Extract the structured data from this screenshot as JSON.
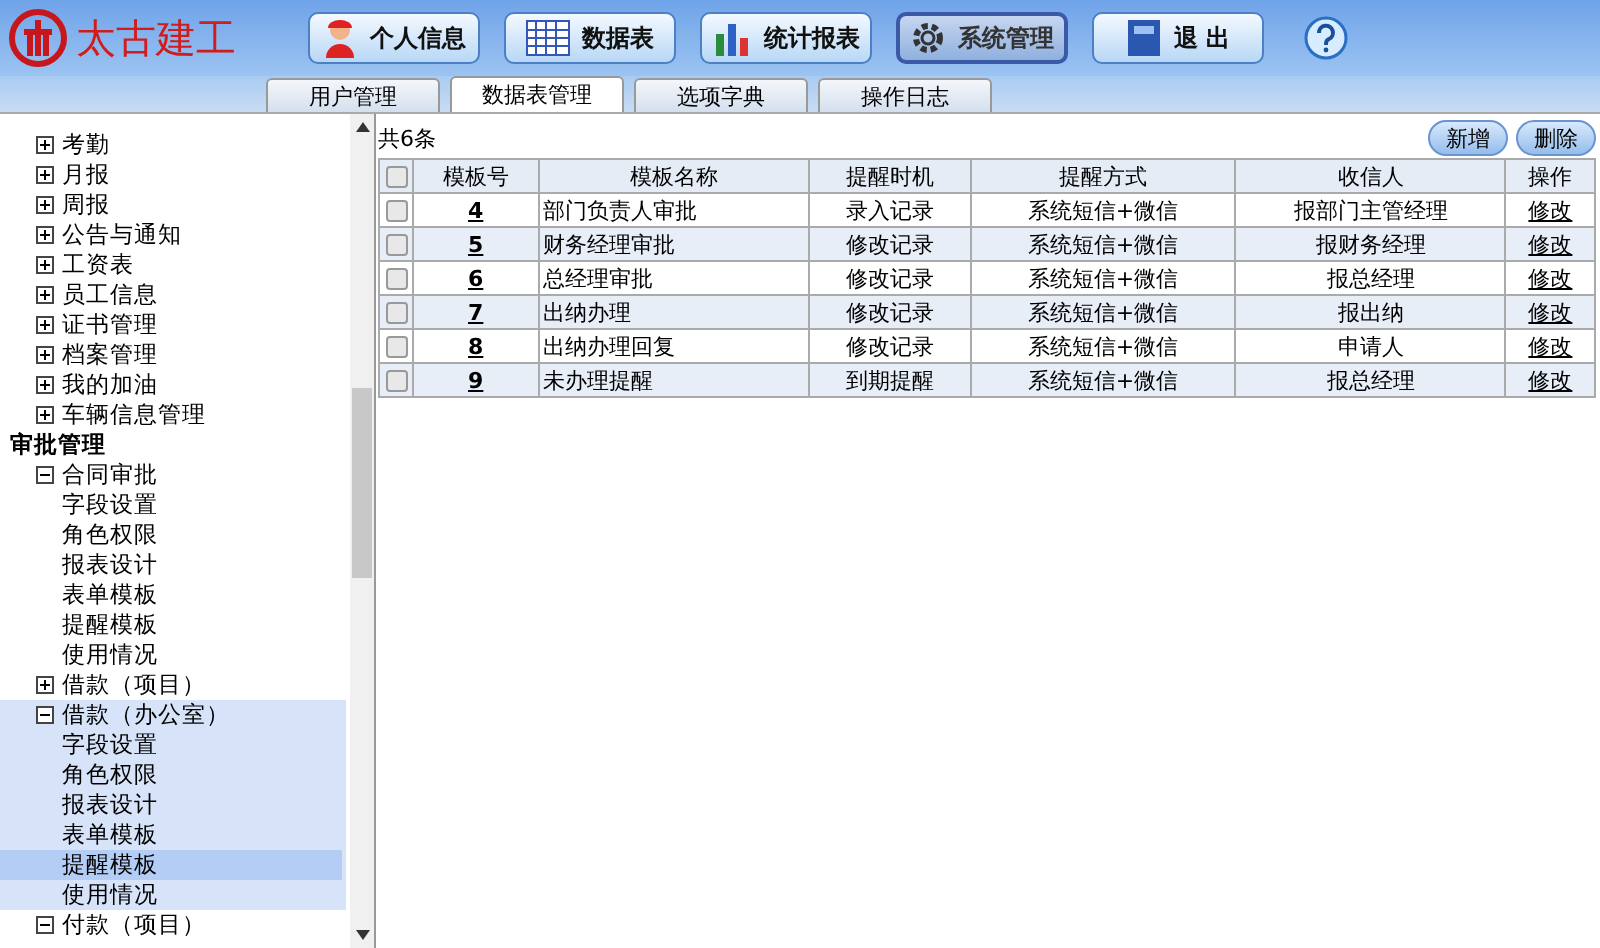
{
  "logo": {
    "text": "太古建工"
  },
  "nav": [
    {
      "label": "个人信息",
      "kind": "person",
      "selected": false
    },
    {
      "label": "数据表",
      "kind": "table",
      "selected": false
    },
    {
      "label": "统计报表",
      "kind": "chart",
      "selected": false
    },
    {
      "label": "系统管理",
      "kind": "settings",
      "selected": true
    },
    {
      "label": "退 出",
      "kind": "exit",
      "selected": false
    }
  ],
  "tabs": [
    {
      "label": "用户管理",
      "selected": false
    },
    {
      "label": "数据表管理",
      "selected": true
    },
    {
      "label": "选项字典",
      "selected": false
    },
    {
      "label": "操作日志",
      "selected": false
    }
  ],
  "sidebar": {
    "items": [
      {
        "kind": "folder",
        "label": "考勤",
        "expanded": false,
        "selected": false
      },
      {
        "kind": "folder",
        "label": "月报",
        "expanded": false,
        "selected": false
      },
      {
        "kind": "folder",
        "label": "周报",
        "expanded": false,
        "selected": false
      },
      {
        "kind": "folder",
        "label": "公告与通知",
        "expanded": false,
        "selected": false
      },
      {
        "kind": "folder",
        "label": "工资表",
        "expanded": false,
        "selected": false
      },
      {
        "kind": "folder",
        "label": "员工信息",
        "expanded": false,
        "selected": false
      },
      {
        "kind": "folder",
        "label": "证书管理",
        "expanded": false,
        "selected": false
      },
      {
        "kind": "folder",
        "label": "档案管理",
        "expanded": false,
        "selected": false
      },
      {
        "kind": "folder",
        "label": "我的加油",
        "expanded": false,
        "selected": false
      },
      {
        "kind": "folder",
        "label": "车辆信息管理",
        "expanded": false,
        "selected": false
      },
      {
        "kind": "group",
        "label": "审批管理"
      },
      {
        "kind": "folder",
        "label": "合同审批",
        "expanded": true,
        "selected": false,
        "children": [
          {
            "label": "字段设置",
            "selected": false
          },
          {
            "label": "角色权限",
            "selected": false
          },
          {
            "label": "报表设计",
            "selected": false
          },
          {
            "label": "表单模板",
            "selected": false
          },
          {
            "label": "提醒模板",
            "selected": false
          },
          {
            "label": "使用情况",
            "selected": false
          }
        ]
      },
      {
        "kind": "folder",
        "label": "借款（项目）",
        "expanded": false,
        "selected": false
      },
      {
        "kind": "folder",
        "label": "借款（办公室）",
        "expanded": true,
        "selected": true,
        "children": [
          {
            "label": "字段设置",
            "selected": false
          },
          {
            "label": "角色权限",
            "selected": false
          },
          {
            "label": "报表设计",
            "selected": false
          },
          {
            "label": "表单模板",
            "selected": false
          },
          {
            "label": "提醒模板",
            "selected": true
          },
          {
            "label": "使用情况",
            "selected": false
          }
        ]
      },
      {
        "kind": "folder",
        "label": "付款（项目）",
        "expanded": true,
        "selected": false
      }
    ]
  },
  "table": {
    "count": "共6条",
    "all_checked": false,
    "buttons": [
      "新增",
      "删除"
    ],
    "columns": [
      "模板号",
      "模板名称",
      "提醒时机",
      "提醒方式",
      "收信人",
      "操作"
    ],
    "rows": [
      {
        "checked": false,
        "cells": [
          "4",
          "部门负责人审批",
          "录入记录",
          "系统短信+微信",
          "报部门主管经理",
          "修改"
        ]
      },
      {
        "checked": false,
        "cells": [
          "5",
          "财务经理审批",
          "修改记录",
          "系统短信+微信",
          "报财务经理",
          "修改"
        ]
      },
      {
        "checked": false,
        "cells": [
          "6",
          "总经理审批",
          "修改记录",
          "系统短信+微信",
          "报总经理",
          "修改"
        ]
      },
      {
        "checked": false,
        "cells": [
          "7",
          "出纳办理",
          "修改记录",
          "系统短信+微信",
          "报出纳",
          "修改"
        ]
      },
      {
        "checked": false,
        "cells": [
          "8",
          "出纳办理回复",
          "修改记录",
          "系统短信+微信",
          "申请人",
          "修改"
        ]
      },
      {
        "checked": false,
        "cells": [
          "9",
          "未办理提醒",
          "到期提醒",
          "系统短信+微信",
          "报总经理",
          "修改"
        ]
      }
    ]
  }
}
